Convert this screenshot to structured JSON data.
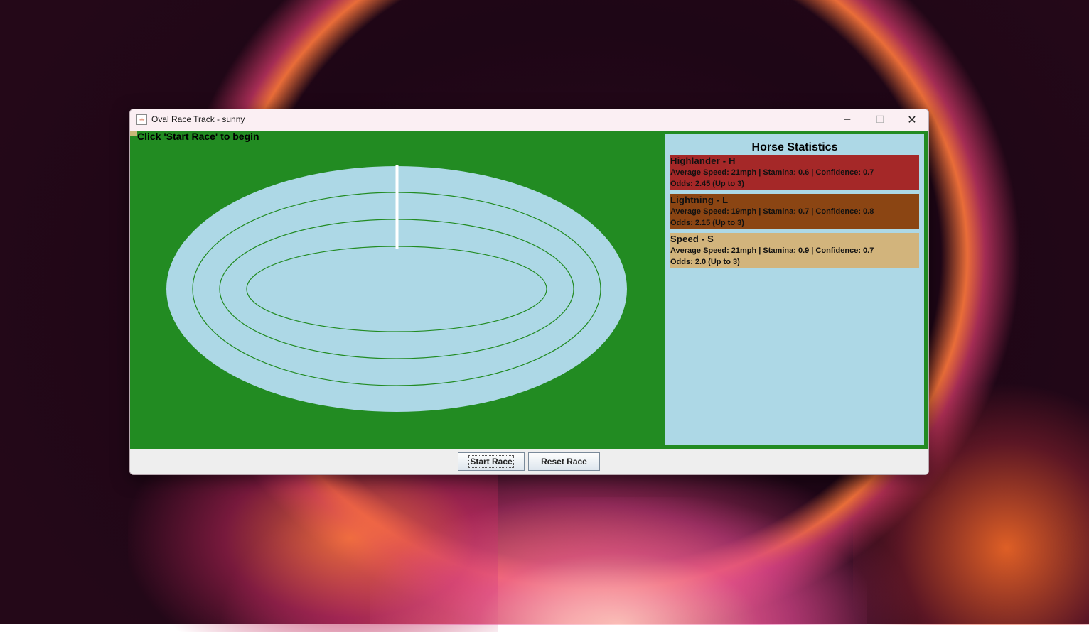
{
  "window": {
    "title": "Oval Race Track - sunny",
    "controls": {
      "minimize": "─",
      "maximize": "☐",
      "close": "✕"
    }
  },
  "race": {
    "status": "Click 'Start Race' to begin",
    "track_color": "#add8e6",
    "grass_color": "#228b22"
  },
  "stats": {
    "title": "Horse Statistics",
    "horses": [
      {
        "name": "Highlander - H",
        "details": "Average Speed: 21mph | Stamina: 0.6 | Confidence: 0.7",
        "odds": "Odds: 2.45 (Up to 3)",
        "color": "#b22222"
      },
      {
        "name": "Lightning - L",
        "details": "Average Speed: 19mph | Stamina: 0.7 | Confidence: 0.8",
        "odds": "Odds: 2.15 (Up to 3)",
        "color": "#8b4513"
      },
      {
        "name": "Speed - S",
        "details": "Average Speed: 21mph | Stamina: 0.9 | Confidence: 0.7",
        "odds": "Odds: 2.0 (Up to 3)",
        "color": "#d2b48c"
      }
    ]
  },
  "buttons": {
    "start": "Start Race",
    "reset": "Reset Race"
  }
}
